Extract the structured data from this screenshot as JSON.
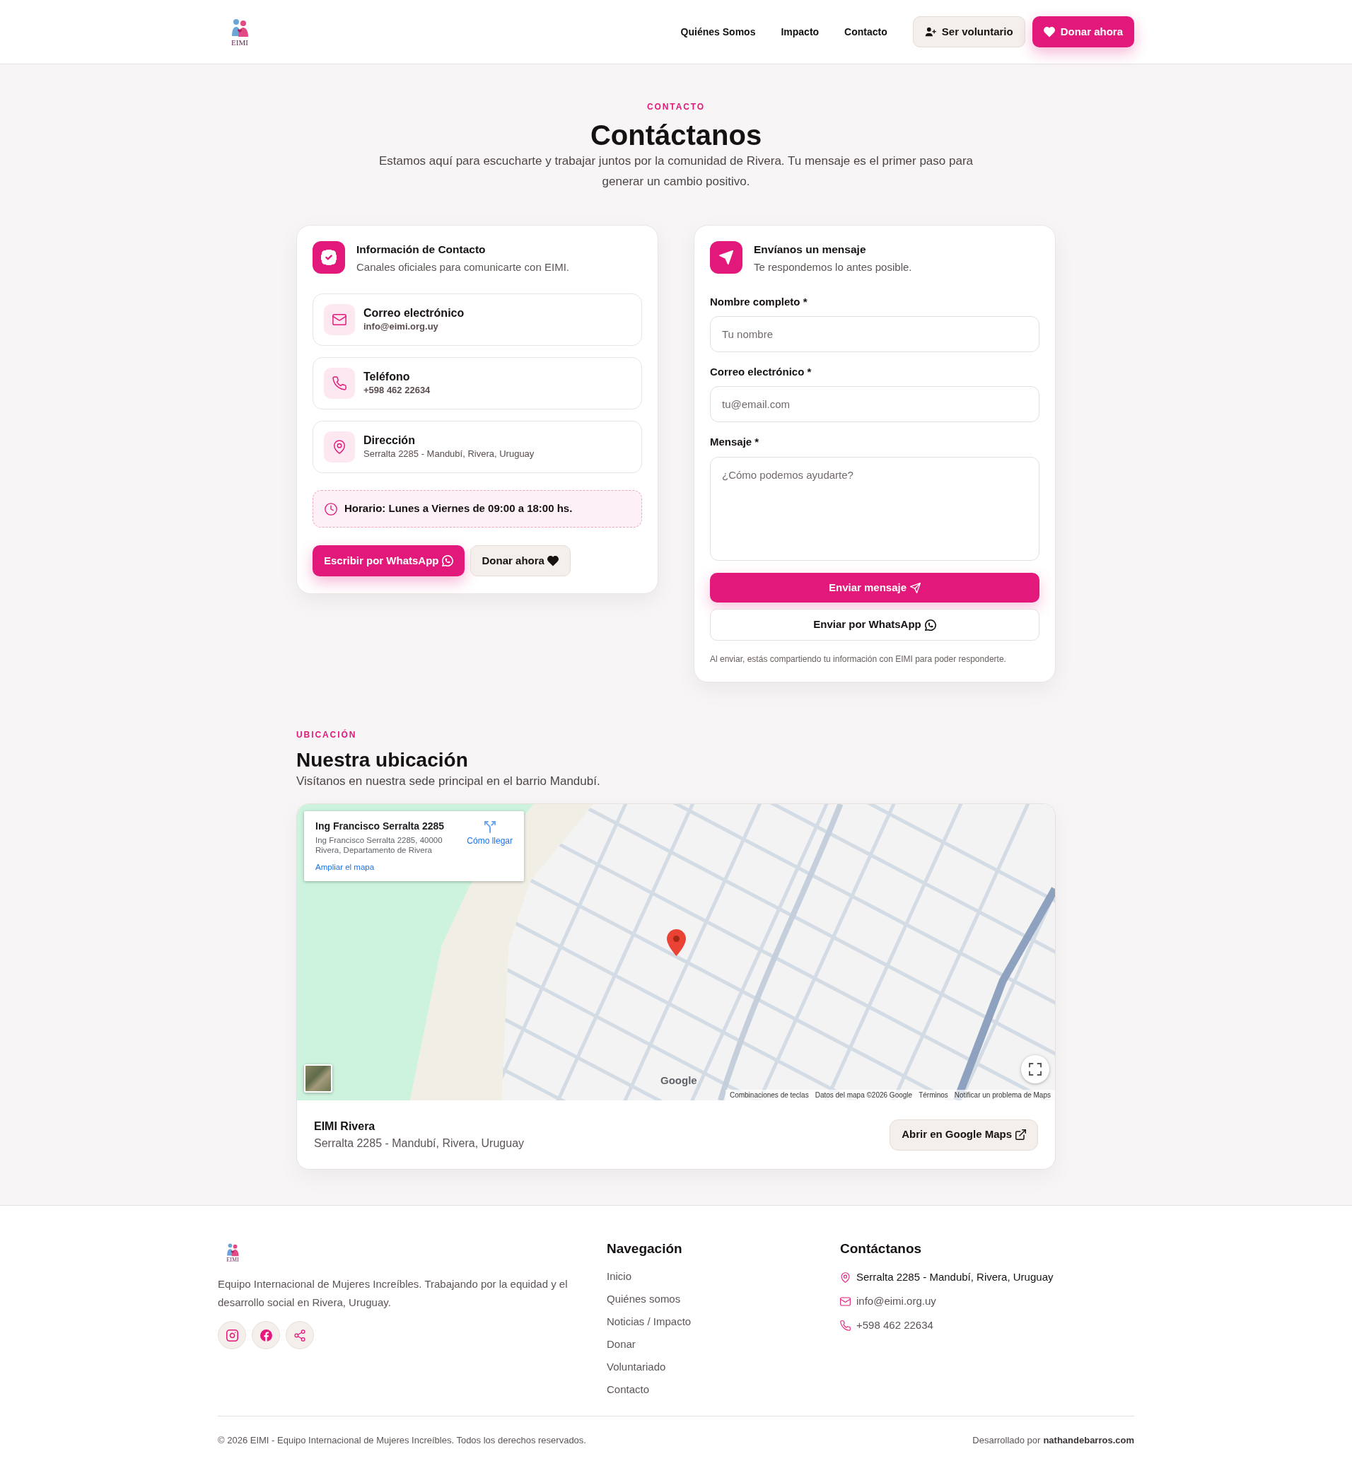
{
  "header": {
    "logo_text": "EIMI",
    "nav": [
      "Quiénes Somos",
      "Impacto",
      "Contacto"
    ],
    "buttons": [
      {
        "kind": "volunteer",
        "label": "Ser voluntario"
      },
      {
        "kind": "donate",
        "label": "Donar ahora"
      }
    ]
  },
  "contact": {
    "eyebrow": "CONTACTO",
    "title": "Contáctanos",
    "intro": "Estamos aquí para escucharte y trabajar juntos por la comunidad de Rivera. Tu mensaje es el primer paso para generar un cambio positivo."
  },
  "info_card": {
    "title": "Información de Contacto",
    "subtitle": "Canales oficiales para comunicarte con EIMI.",
    "items": [
      {
        "kind": "email",
        "label": "Correo electrónico",
        "value": "info@eimi.org.uy"
      },
      {
        "kind": "phone",
        "label": "Teléfono",
        "value": "+598 462 22634"
      },
      {
        "kind": "address",
        "label": "Dirección",
        "value": "Serralta 2285 - Mandubí, Rivera, Uruguay"
      }
    ],
    "hours": "Horario: Lunes a Viernes de 09:00 a 18:00 hs.",
    "buttons": [
      {
        "kind": "whatsapp",
        "label": "Escribir por WhatsApp"
      },
      {
        "kind": "donate",
        "label": "Donar ahora"
      }
    ]
  },
  "form_card": {
    "title": "Envíanos un mensaje",
    "subtitle": "Te respondemos lo antes posible.",
    "fields": [
      {
        "kind": "text",
        "label": "Nombre completo *",
        "placeholder": "Tu nombre"
      },
      {
        "kind": "email",
        "label": "Correo electrónico *",
        "placeholder": "tu@email.com"
      },
      {
        "kind": "textarea",
        "label": "Mensaje *",
        "placeholder": "¿Cómo podemos ayudarte?"
      }
    ],
    "buttons": [
      {
        "kind": "submit",
        "label": "Enviar mensaje"
      },
      {
        "kind": "whatsapp",
        "label": "Enviar por WhatsApp"
      }
    ],
    "note": "Al enviar, estás compartiendo tu información con EIMI para poder responderte."
  },
  "location": {
    "eyebrow": "UBICACIÓN",
    "title": "Nuestra ubicación",
    "subtitle": "Visítanos en nuestra sede principal en el barrio Mandubí.",
    "map": {
      "place_card": {
        "title": "Ing Francisco Serralta 2285",
        "address": "Ing Francisco Serralta 2285, 40000 Rivera, Departamento de Rivera",
        "directions": "Cómo llegar",
        "enlarge": "Ampliar el mapa"
      },
      "logo": "Google",
      "attribution": [
        "Combinaciones de teclas",
        "Datos del mapa ©2026 Google",
        "Términos",
        "Notificar un problema de Maps"
      ]
    },
    "place_name": "EIMI Rivera",
    "address": "Serralta 2285 - Mandubí, Rivera, Uruguay",
    "button": "Abrir en Google Maps"
  },
  "footer": {
    "logo_text": "EIMI",
    "description": "Equipo Internacional de Mujeres Increíbles. Trabajando por la equidad y el desarrollo social en Rivera, Uruguay.",
    "socials": [
      {
        "kind": "instagram"
      },
      {
        "kind": "facebook"
      },
      {
        "kind": "share"
      }
    ],
    "navigation": {
      "title": "Navegación",
      "links": [
        "Inicio",
        "Quiénes somos",
        "Noticias / Impacto",
        "Donar",
        "Voluntariado",
        "Contacto"
      ]
    },
    "contact": {
      "title": "Contáctanos",
      "items": [
        {
          "kind": "address",
          "text": "Serralta 2285 - Mandubí, Rivera, Uruguay"
        },
        {
          "kind": "email",
          "text": "info@eimi.org.uy"
        },
        {
          "kind": "phone",
          "text": "+598 462 22634"
        }
      ]
    },
    "copyright": "© 2026 EIMI - Equipo Internacional de Mujeres Increíbles. Todos los derechos reservados.",
    "credit_label": "Desarrollado por",
    "credit_link": "nathandebarros.com"
  }
}
